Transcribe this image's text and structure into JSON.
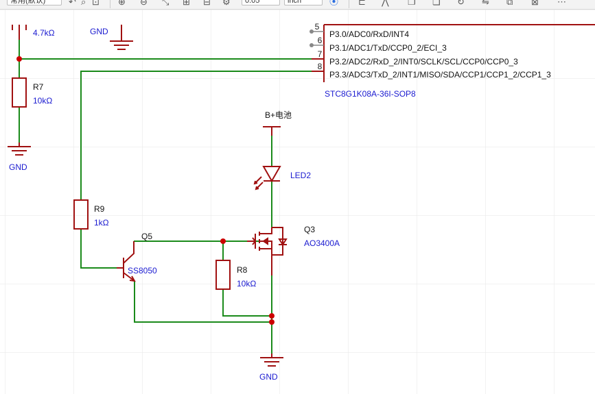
{
  "toolbar": {
    "font_select_value": "常用(默认)",
    "zoom_value": "0.05",
    "unit_value": "inch",
    "icons": [
      "zoom-in-icon",
      "zoom-out-icon",
      "fit-icon",
      "zoom-area-icon",
      "grid-icon",
      "settings-icon",
      "align-icon",
      "wire-icon",
      "copy-icon",
      "paste-icon",
      "more-icon"
    ]
  },
  "mcu": {
    "part_number": "STC8G1K08A-36I-SOP8",
    "pins": [
      {
        "number": "5",
        "label": "P3.0/ADC0/RxD/INT4"
      },
      {
        "number": "6",
        "label": "P3.1/ADC1/TxD/CCP0_2/ECI_3"
      },
      {
        "number": "7",
        "label": "P3.2/ADC2/RxD_2/INT0/SCLK/SCL/CCP0/CCP0_3"
      },
      {
        "number": "8",
        "label": "P3.3/ADC3/TxD_2/INT1/MISO/SDA/CCP1/CCP1_2/CCP1_3"
      }
    ]
  },
  "components": {
    "r_top_value": "4.7kΩ",
    "r7": {
      "ref": "R7",
      "value": "10kΩ"
    },
    "r9": {
      "ref": "R9",
      "value": "1kΩ"
    },
    "r8": {
      "ref": "R8",
      "value": "10kΩ"
    },
    "q5": {
      "ref": "Q5",
      "value": "SS8050"
    },
    "q3": {
      "ref": "Q3",
      "value": "AO3400A"
    },
    "led2": {
      "ref": "LED2"
    }
  },
  "nets": {
    "battery": "B+电池",
    "gnd_top": "GND",
    "gnd_left": "GND",
    "gnd_bottom": "GND"
  },
  "colors": {
    "component": "#a01010",
    "wire": "#1a8a1a",
    "label": "#1a1ad0",
    "grid": "#e6e6e6",
    "junction": "#cc0000"
  }
}
